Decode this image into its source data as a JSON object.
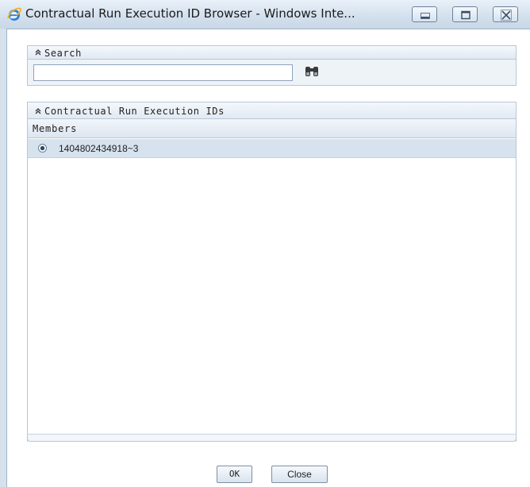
{
  "window": {
    "title": "Contractual Run Execution ID Browser - Windows Inte...",
    "icon": "internet-explorer-icon",
    "controls": [
      "minimize-icon",
      "maximize-icon",
      "close-icon"
    ]
  },
  "search": {
    "section_title": "Search",
    "input_value": "",
    "search_button_icon": "binoculars-icon"
  },
  "ids": {
    "section_title": "Contractual Run Execution IDs",
    "column_header": "Members",
    "members": [
      {
        "label": "1404802434918~3",
        "selected": true
      }
    ]
  },
  "footer": {
    "ok_label": "OK",
    "close_label": "Close"
  },
  "colors": {
    "titlebar": "#d4e1ee",
    "selected_row": "#d6e3ee",
    "panel_border": "#b9c6d6"
  }
}
